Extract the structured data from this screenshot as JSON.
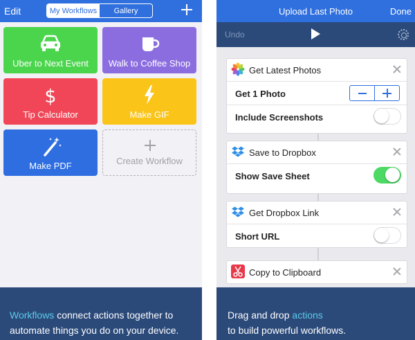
{
  "left": {
    "nav": {
      "edit": "Edit",
      "tabs": [
        "My Workflows",
        "Gallery"
      ],
      "add_icon": "plus-icon"
    },
    "tiles": [
      {
        "label": "Uber to Next Event",
        "color": "#4bd54d",
        "icon": "car-icon"
      },
      {
        "label": "Walk to Coffee Shop",
        "color": "#8b6de0",
        "icon": "mug-icon"
      },
      {
        "label": "Tip Calculator",
        "color": "#f04658",
        "icon": "dollar-icon"
      },
      {
        "label": "Make GIF",
        "color": "#fac419",
        "icon": "bolt-icon"
      },
      {
        "label": "Make PDF",
        "color": "#2e6ee0",
        "icon": "magic-wand-icon"
      },
      {
        "label": "Create Workflow",
        "icon": "plus-icon"
      }
    ],
    "footer": {
      "highlight": "Workflows",
      "rest": " connect actions together to automate things you do on your device."
    }
  },
  "right": {
    "nav": {
      "title": "Upload Last Photo",
      "done": "Done"
    },
    "toolbar": {
      "undo": "Undo",
      "run_icon": "play-icon",
      "settings_icon": "gear-icon"
    },
    "actions": [
      {
        "title": "Get Latest Photos",
        "icon": "photos-icon",
        "rows": [
          {
            "label": "Get 1 Photo",
            "control": "stepper"
          },
          {
            "label": "Include Screenshots",
            "control": "toggle",
            "on": false
          }
        ]
      },
      {
        "title": "Save to Dropbox",
        "icon": "dropbox-icon",
        "rows": [
          {
            "label": "Show Save Sheet",
            "control": "toggle",
            "on": true
          }
        ]
      },
      {
        "title": "Get Dropbox Link",
        "icon": "dropbox-icon",
        "rows": [
          {
            "label": "Short URL",
            "control": "toggle",
            "on": false
          }
        ]
      },
      {
        "title": "Copy to Clipboard",
        "icon": "scissors-icon",
        "rows": []
      }
    ],
    "footer": {
      "before": "Drag and drop ",
      "highlight": "actions",
      "after": "to build powerful workflows."
    }
  }
}
